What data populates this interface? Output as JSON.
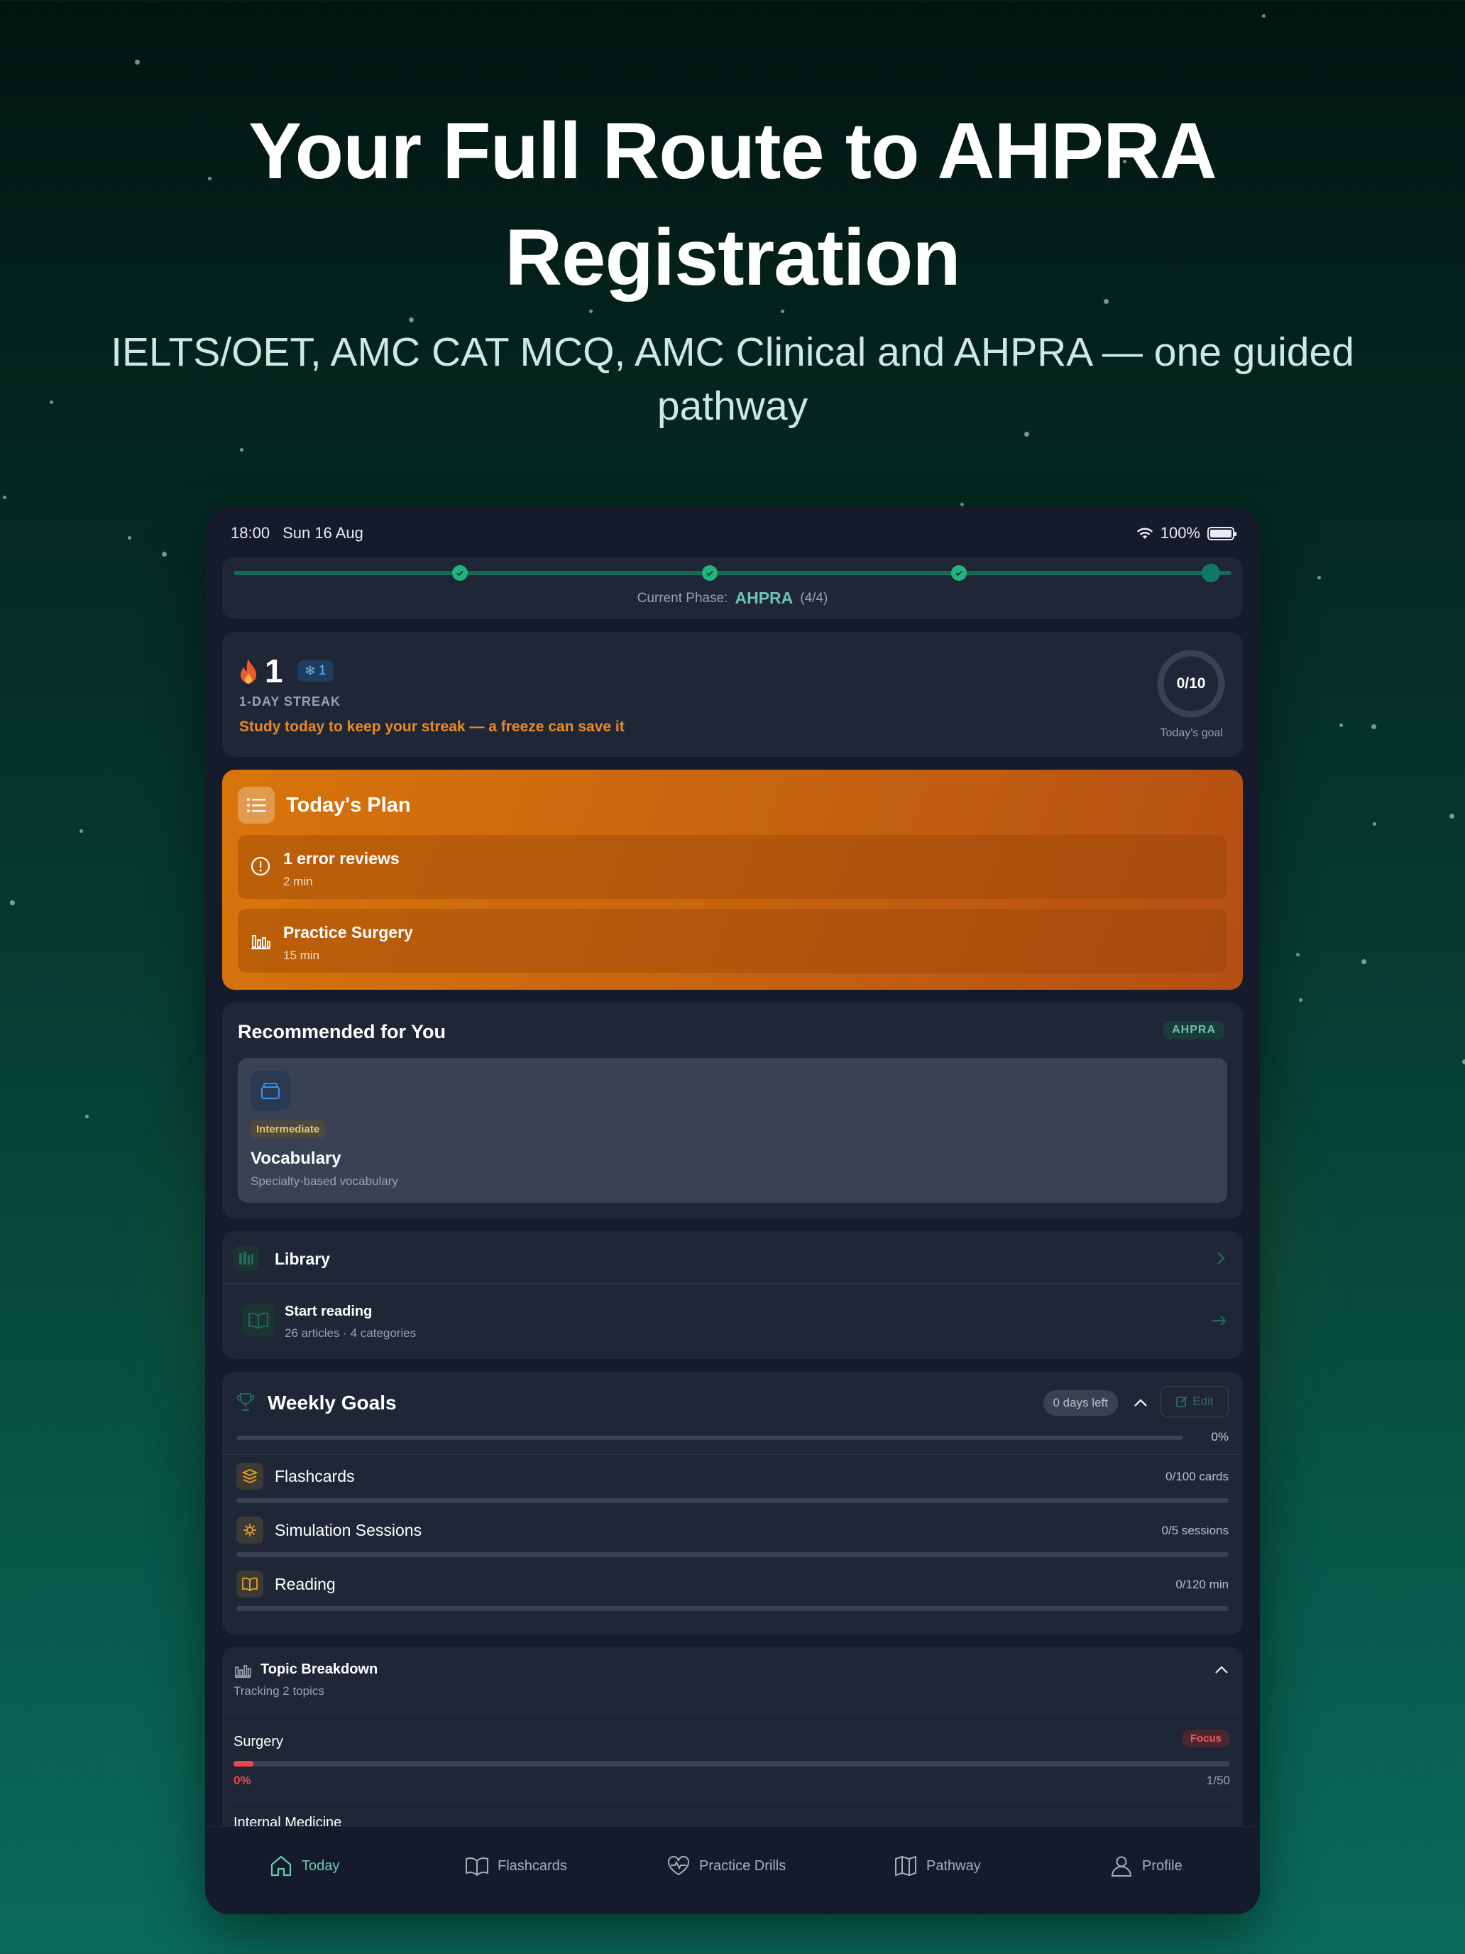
{
  "promo": {
    "headline_line1": "Your Full Route to AHPRA",
    "headline_line2": "Registration",
    "subline_line1": "IELTS/OET, AMC CAT MCQ, AMC Clinical and AHPRA — one guided",
    "subline_line2": "pathway"
  },
  "status_bar": {
    "time": "18:00",
    "date": "Sun 16 Aug",
    "battery": "100%"
  },
  "phase": {
    "label": "Current Phase:",
    "name": "AHPRA",
    "count": "(4/4)",
    "completed": 3,
    "total": 4
  },
  "streak": {
    "count": "1",
    "freezes": "1",
    "label": "1-DAY STREAK",
    "message": "Study today to keep your streak — a freeze can save it",
    "goal_value": "0/10",
    "goal_progress": 0,
    "goal_label": "Today's goal"
  },
  "plan": {
    "title": "Today's Plan",
    "items": [
      {
        "title": "1 error reviews",
        "duration": "2 min",
        "icon": "alert-circle-icon"
      },
      {
        "title": "Practice Surgery",
        "duration": "15 min",
        "icon": "bar-chart-icon"
      }
    ]
  },
  "recommended": {
    "title": "Recommended for You",
    "badge": "AHPRA",
    "card": {
      "level": "Intermediate",
      "name": "Vocabulary",
      "description": "Specialty-based vocabulary"
    }
  },
  "library": {
    "title": "Library",
    "row_title": "Start reading",
    "row_subtitle": "26 articles · 4 categories"
  },
  "weekly_goals": {
    "title": "Weekly Goals",
    "days_left": "0 days left",
    "edit_label": "Edit",
    "overall_percent": "0%",
    "overall_progress": 0,
    "items": [
      {
        "name": "Flashcards",
        "value": "0/100 cards",
        "progress": 0,
        "icon": "stack-icon"
      },
      {
        "name": "Simulation Sessions",
        "value": "0/5 sessions",
        "progress": 0,
        "icon": "sim-icon"
      },
      {
        "name": "Reading",
        "value": "0/120 min",
        "progress": 0,
        "icon": "book-icon"
      }
    ]
  },
  "topics": {
    "title": "Topic Breakdown",
    "subtitle": "Tracking 2 topics",
    "items": [
      {
        "name": "Surgery",
        "badge": "Focus",
        "percent": "0%",
        "count": "1/50",
        "progress": 0.02
      },
      {
        "name": "Internal Medicine"
      }
    ]
  },
  "tabs": [
    {
      "label": "Today",
      "active": true
    },
    {
      "label": "Flashcards",
      "active": false
    },
    {
      "label": "Practice Drills",
      "active": false
    },
    {
      "label": "Pathway",
      "active": false
    },
    {
      "label": "Profile",
      "active": false
    }
  ],
  "colors": {
    "accent": "#6ac7b0",
    "orange": "#d9750b",
    "card": "#1f2636",
    "device_bg": "#151b2b",
    "danger": "#ef4747"
  }
}
